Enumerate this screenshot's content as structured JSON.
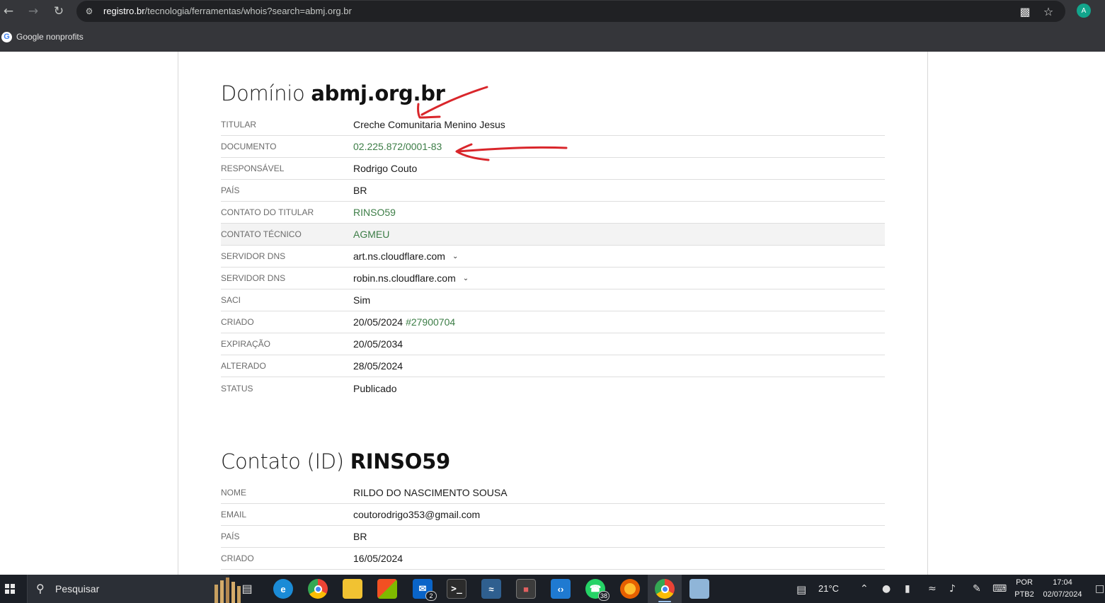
{
  "browser": {
    "url_host": "registro.br",
    "url_path": "/tecnologia/ferramentas/whois?search=abmj.org.br",
    "profile_initial": "A",
    "bookmark_label": "Google nonprofits",
    "icons": [
      "back-icon",
      "forward-icon",
      "reload-icon",
      "site-settings-icon",
      "install-icon",
      "star-icon"
    ]
  },
  "domain": {
    "heading_prefix": "Domínio",
    "heading_name": "abmj.org.br",
    "rows": [
      {
        "label": "TITULAR",
        "value": "Creche Comunitaria Menino Jesus"
      },
      {
        "label": "DOCUMENTO",
        "value": "02.225.872/0001-83"
      },
      {
        "label": "RESPONSÁVEL",
        "value": "Rodrigo Couto"
      },
      {
        "label": "PAÍS",
        "value": "BR"
      },
      {
        "label": "CONTATO DO TITULAR",
        "value": "RINSO59"
      },
      {
        "label": "CONTATO TÉCNICO",
        "value": "AGMEU"
      },
      {
        "label": "SERVIDOR DNS",
        "value": "art.ns.cloudflare.com"
      },
      {
        "label": "SERVIDOR DNS",
        "value": "robin.ns.cloudflare.com"
      },
      {
        "label": "SACI",
        "value": "Sim"
      },
      {
        "label": "CRIADO",
        "value": "20/05/2024",
        "extra": "#27900704"
      },
      {
        "label": "EXPIRAÇÃO",
        "value": "20/05/2034"
      },
      {
        "label": "ALTERADO",
        "value": "28/05/2024"
      },
      {
        "label": "STATUS",
        "value": "Publicado"
      }
    ]
  },
  "contact": {
    "heading_prefix": "Contato (ID)",
    "heading_name": "RINSO59",
    "rows": [
      {
        "label": "NOME",
        "value": "RILDO DO NASCIMENTO SOUSA"
      },
      {
        "label": "EMAIL",
        "value": "coutorodrigo353@gmail.com"
      },
      {
        "label": "PAÍS",
        "value": "BR"
      },
      {
        "label": "CRIADO",
        "value": "16/05/2024"
      }
    ]
  },
  "colors": {
    "link": "#3c7d46",
    "annotation": "#d9262b",
    "chrome": "#35363a",
    "taskbar": "#1b1f26"
  },
  "taskbar": {
    "search_placeholder": "Pesquisar",
    "mail_badge": "2",
    "whatsapp_badge": "38",
    "weather": "21°C",
    "lang_line1": "POR",
    "lang_line2": "PTB2",
    "time": "17:04",
    "date": "02/07/2024",
    "apps": [
      "task-view-icon",
      "edge-icon",
      "chrome-icon",
      "file-explorer-icon",
      "store-icon",
      "mail-icon",
      "terminal-icon",
      "mysql-workbench-icon",
      "image-editor-icon",
      "vscode-icon",
      "whatsapp-icon",
      "firefox-icon",
      "chrome-profile-icon",
      "notepad-icon"
    ]
  }
}
